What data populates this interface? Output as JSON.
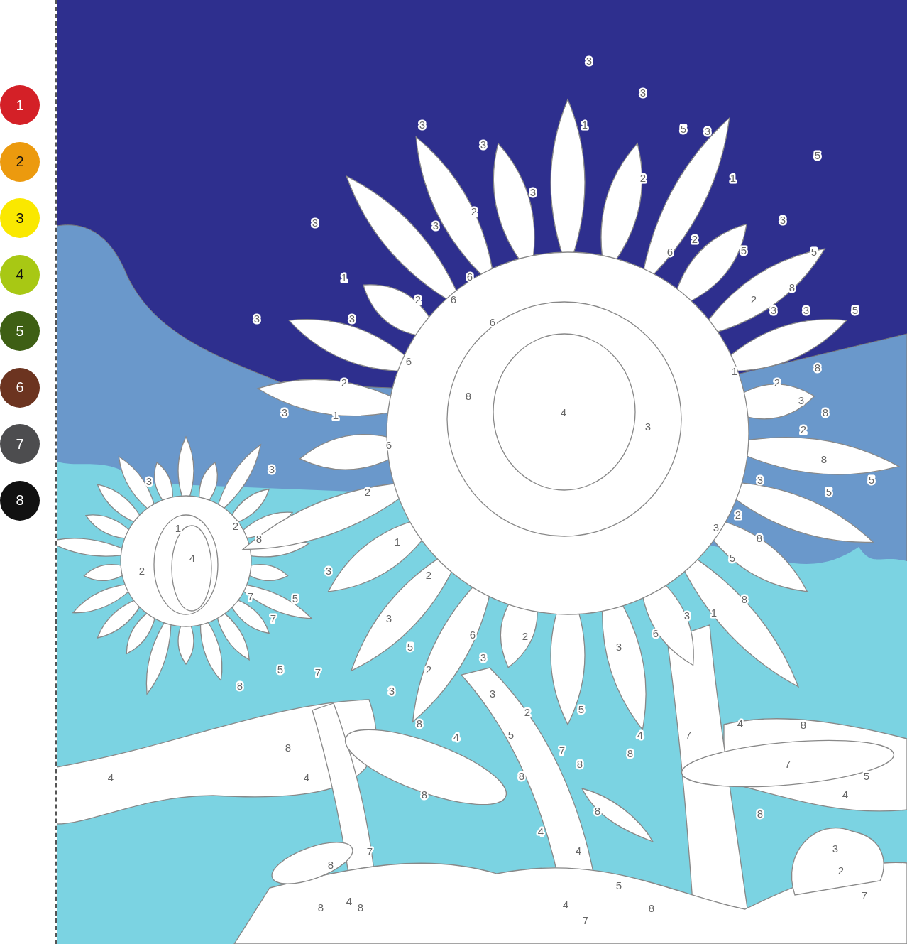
{
  "palette": [
    {
      "label": "1",
      "color": "#d42027"
    },
    {
      "label": "2",
      "color": "#ec9a0e"
    },
    {
      "label": "3",
      "color": "#fae800"
    },
    {
      "label": "4",
      "color": "#a8c814"
    },
    {
      "label": "5",
      "color": "#3e5f14"
    },
    {
      "label": "6",
      "color": "#6c3420"
    },
    {
      "label": "7",
      "color": "#4d4d4f"
    },
    {
      "label": "8",
      "color": "#111111"
    }
  ],
  "canvas": {
    "numbers": [
      "3",
      "3",
      "3",
      "1",
      "5",
      "3",
      "3",
      "5",
      "2",
      "1",
      "3",
      "2",
      "3",
      "3",
      "3",
      "2",
      "6",
      "5",
      "5",
      "1",
      "6",
      "8",
      "2",
      "6",
      "2",
      "3",
      "3",
      "5",
      "3",
      "3",
      "6",
      "6",
      "1",
      "8",
      "2",
      "2",
      "8",
      "3",
      "3",
      "1",
      "4",
      "8",
      "3",
      "2",
      "6",
      "8",
      "3",
      "3",
      "3",
      "5",
      "2",
      "5",
      "2",
      "1",
      "2",
      "3",
      "8",
      "1",
      "8",
      "4",
      "5",
      "2",
      "3",
      "2",
      "7",
      "5",
      "8",
      "7",
      "3",
      "3",
      "1",
      "6",
      "2",
      "6",
      "5",
      "3",
      "3",
      "5",
      "7",
      "2",
      "8",
      "3",
      "3",
      "2",
      "5",
      "8",
      "4",
      "8",
      "4",
      "5",
      "4",
      "7",
      "8",
      "7",
      "8",
      "8",
      "7",
      "4",
      "4",
      "8",
      "5",
      "8",
      "4",
      "8",
      "8",
      "4",
      "7",
      "4",
      "3",
      "8",
      "2",
      "5",
      "7",
      "8",
      "4",
      "8",
      "4",
      "8",
      "7"
    ]
  }
}
